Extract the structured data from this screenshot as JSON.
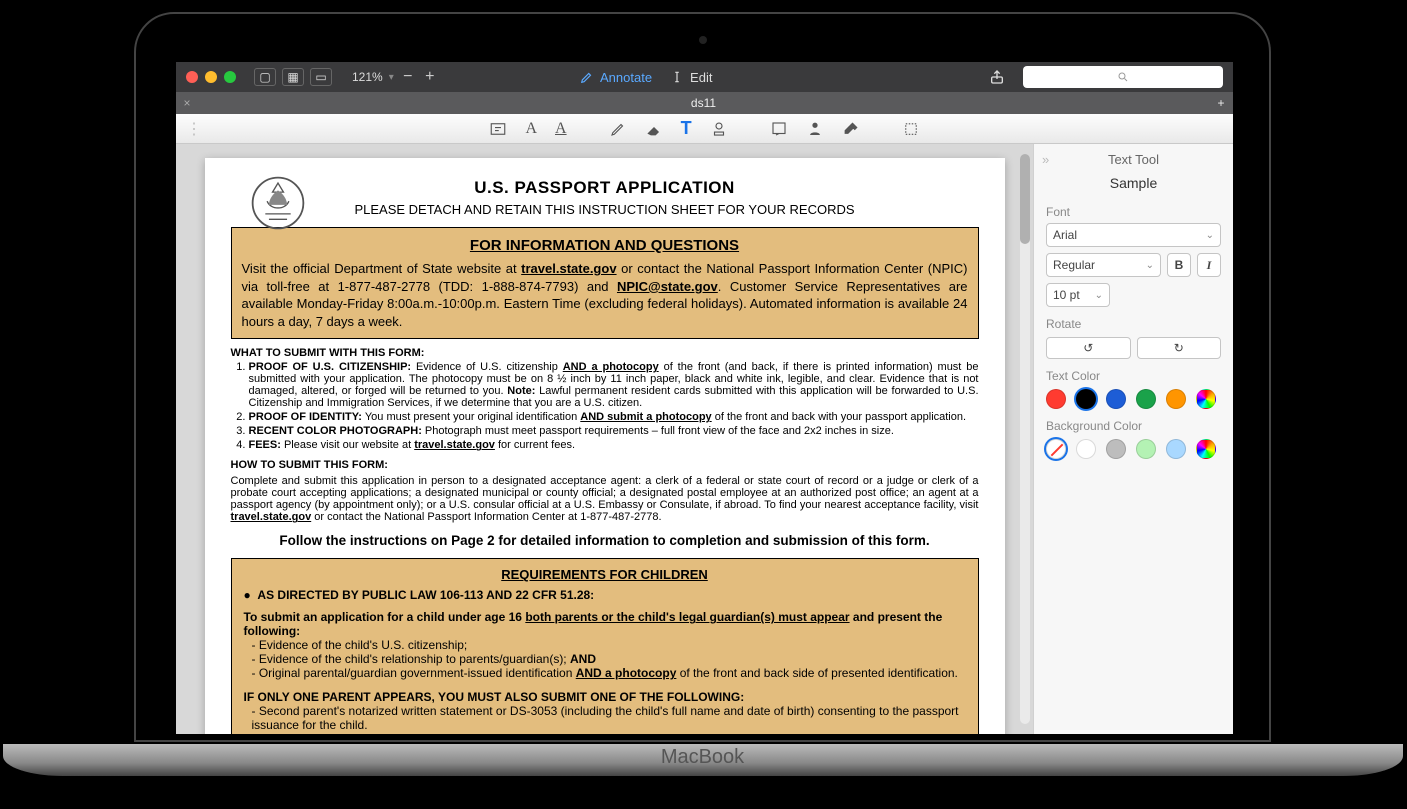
{
  "toolbar": {
    "zoom": "121%",
    "annotate": "Annotate",
    "edit": "Edit",
    "search_placeholder": ""
  },
  "tab": {
    "name": "ds11"
  },
  "inspector": {
    "title": "Text Tool",
    "sample": "Sample",
    "font_label": "Font",
    "font_family": "Arial",
    "font_style": "Regular",
    "font_size": "10 pt",
    "rotate_label": "Rotate",
    "text_color_label": "Text Color",
    "bg_color_label": "Background Color",
    "text_colors": [
      "#ff3b30",
      "#000000",
      "#1d5dd6",
      "#1aa24a",
      "#ff9500",
      "rainbow"
    ],
    "text_color_selected": 1,
    "bg_colors": [
      "none",
      "#ffffff",
      "#bdbdbd",
      "#b4f2b4",
      "#a9d8ff",
      "rainbow"
    ],
    "bg_color_selected": 0
  },
  "doc": {
    "title": "U.S. PASSPORT APPLICATION",
    "subtitle": "PLEASE DETACH AND RETAIN THIS INSTRUCTION SHEET FOR YOUR RECORDS",
    "info_heading": "FOR INFORMATION AND QUESTIONS",
    "info_body_1": "Visit the official Department of State website at ",
    "info_link_1": "travel.state.gov",
    "info_body_2": " or contact the National Passport Information Center (NPIC) via toll-free at 1-877-487-2778 (TDD: 1-888-874-7793) and ",
    "info_link_2": "NPIC@state.gov",
    "info_body_3": ".  Customer Service Representatives are available Monday-Friday 8:00a.m.-10:00p.m. Eastern Time (excluding federal holidays). Automated information is available 24 hours a day, 7 days a week.",
    "what_head": "WHAT TO SUBMIT WITH THIS FORM:",
    "what_items": [
      {
        "lead": "PROOF OF U.S. CITIZENSHIP:",
        "text": " Evidence of U.S. citizenship ",
        "u": "AND a photocopy",
        "rest": " of the front (and back, if there is printed information) must be submitted with your application. The photocopy must be on 8 ½ inch by 11 inch paper, black and white ink, legible, and clear. Evidence that is not damaged, altered, or forged will be returned to you. ",
        "note": "Note:",
        "note_rest": " Lawful permanent resident cards submitted with this application will be forwarded to U.S. Citizenship and Immigration Services, if we determine that you are a U.S. citizen."
      },
      {
        "lead": "PROOF OF IDENTITY:",
        "text": " You must present your original identification ",
        "u": "AND submit a photocopy",
        "rest": " of the front and back with your passport application."
      },
      {
        "lead": "RECENT COLOR PHOTOGRAPH:",
        "text": " Photograph must meet passport requirements – full front view of the face and 2x2 inches in size."
      },
      {
        "lead": "FEES:",
        "text": " Please visit our website at ",
        "u": "travel.state.gov",
        "rest": " for current fees."
      }
    ],
    "how_head": "HOW TO SUBMIT THIS FORM:",
    "how_body": "Complete and submit this application in person to a designated acceptance agent:  a clerk of a federal or state court of record or a judge or clerk of a probate court accepting applications; a designated municipal or county official; a designated postal employee at an authorized post office; an agent at a passport agency (by appointment only); or a U.S. consular official at a U.S. Embassy or Consulate, if abroad.  To find your nearest acceptance facility, visit ",
    "how_link": "travel.state.gov",
    "how_rest": " or contact the National Passport Information Center at 1-877-487-2778.",
    "follow": "Follow the instructions on Page 2 for detailed information to completion and submission of this form.",
    "req_head": "REQUIREMENTS FOR CHILDREN",
    "req_law": "AS DIRECTED BY PUBLIC LAW 106-113 AND 22 CFR 51.28:",
    "req_intro_1": "To submit an application for a child under age 16 ",
    "req_intro_u": "both parents or the child's legal guardian(s) must appear",
    "req_intro_2": " and present the following:",
    "req_items": [
      "Evidence of the child's U.S. citizenship;",
      "Evidence of the child's relationship to parents/guardian(s); AND",
      "Original parental/guardian government-issued identification AND a photocopy of the front and back side of presented identification."
    ],
    "one_parent_head": "IF ONLY ONE PARENT APPEARS, YOU MUST ALSO SUBMIT ONE OF THE FOLLOWING:",
    "one_parent_item": "Second parent's notarized written statement or DS-3053 (including the child's full name and date of birth) consenting to the passport issuance for the child."
  },
  "brand": "MacBook"
}
